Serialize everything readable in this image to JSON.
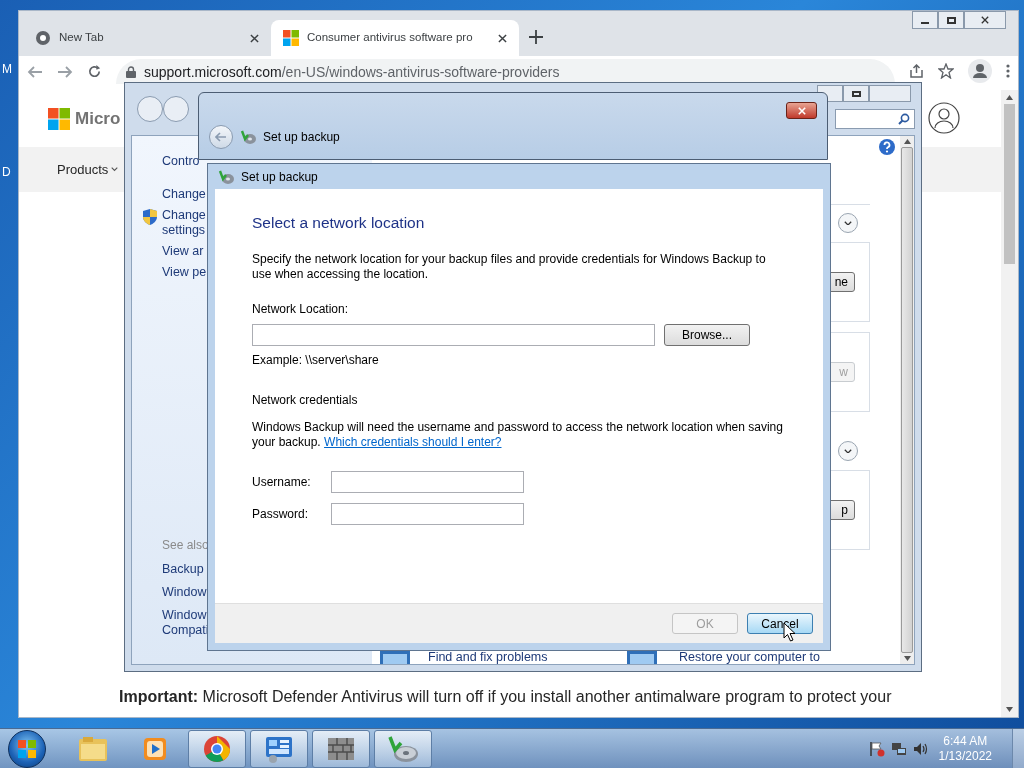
{
  "desktop_labels": [
    "M",
    "D"
  ],
  "browser": {
    "tabs": [
      {
        "label": "New Tab",
        "selected": false
      },
      {
        "label": "Consumer antivirus software pro",
        "selected": true
      }
    ],
    "url_host": "support.microsoft.com",
    "url_path": "/en-US/windows-antivirus-software-providers",
    "page": {
      "logo_text": "Micro",
      "nav_item": "Products",
      "important": "**Important:** Microsoft Defender Antivirus will turn off if you install another antimalware program to protect your"
    }
  },
  "control_panel": {
    "left_links": [
      {
        "label": "Contro",
        "kind": "plain"
      },
      {
        "label": "Change",
        "kind": "plain"
      },
      {
        "label": "Change settings",
        "kind": "shield"
      },
      {
        "label": "View ar",
        "kind": "plain"
      },
      {
        "label": "View pe",
        "kind": "plain"
      }
    ],
    "see_also": "See also",
    "see_also_links": [
      "Backup",
      "Window",
      "Window Compati"
    ],
    "section_buttons": [
      {
        "label": "ne",
        "disabled": false
      },
      {
        "label": "w",
        "disabled": true
      },
      {
        "label": "p",
        "disabled": false
      }
    ],
    "tasks": [
      "Find and fix problems",
      "Restore your computer to"
    ]
  },
  "dialog": {
    "outer_title": "Set up backup",
    "inner_title": "Set up backup",
    "heading": "Select a network location",
    "intro": "Specify the network location for your backup files and provide credentials for Windows Backup to use when accessing the location.",
    "location_label": "Network Location:",
    "browse": "Browse...",
    "example": "Example: \\\\server\\share",
    "credentials_heading": "Network credentials",
    "credentials_text": "Windows Backup will need the username and password to access the network location when saving your backup.",
    "credentials_link": "Which credentials should I enter?",
    "username_label": "Username:",
    "password_label": "Password:",
    "buttons": [
      {
        "label": "OK",
        "disabled": true
      },
      {
        "label": "Cancel",
        "disabled": false
      }
    ]
  },
  "taskbar": {
    "items": [
      {
        "kind": "folder",
        "running": false
      },
      {
        "kind": "media",
        "running": false
      },
      {
        "kind": "chrome",
        "running": true
      },
      {
        "kind": "control",
        "running": true
      },
      {
        "kind": "wall",
        "running": true
      },
      {
        "kind": "backup",
        "running": true
      }
    ],
    "time": "6:44 AM",
    "date": "1/13/2022"
  }
}
